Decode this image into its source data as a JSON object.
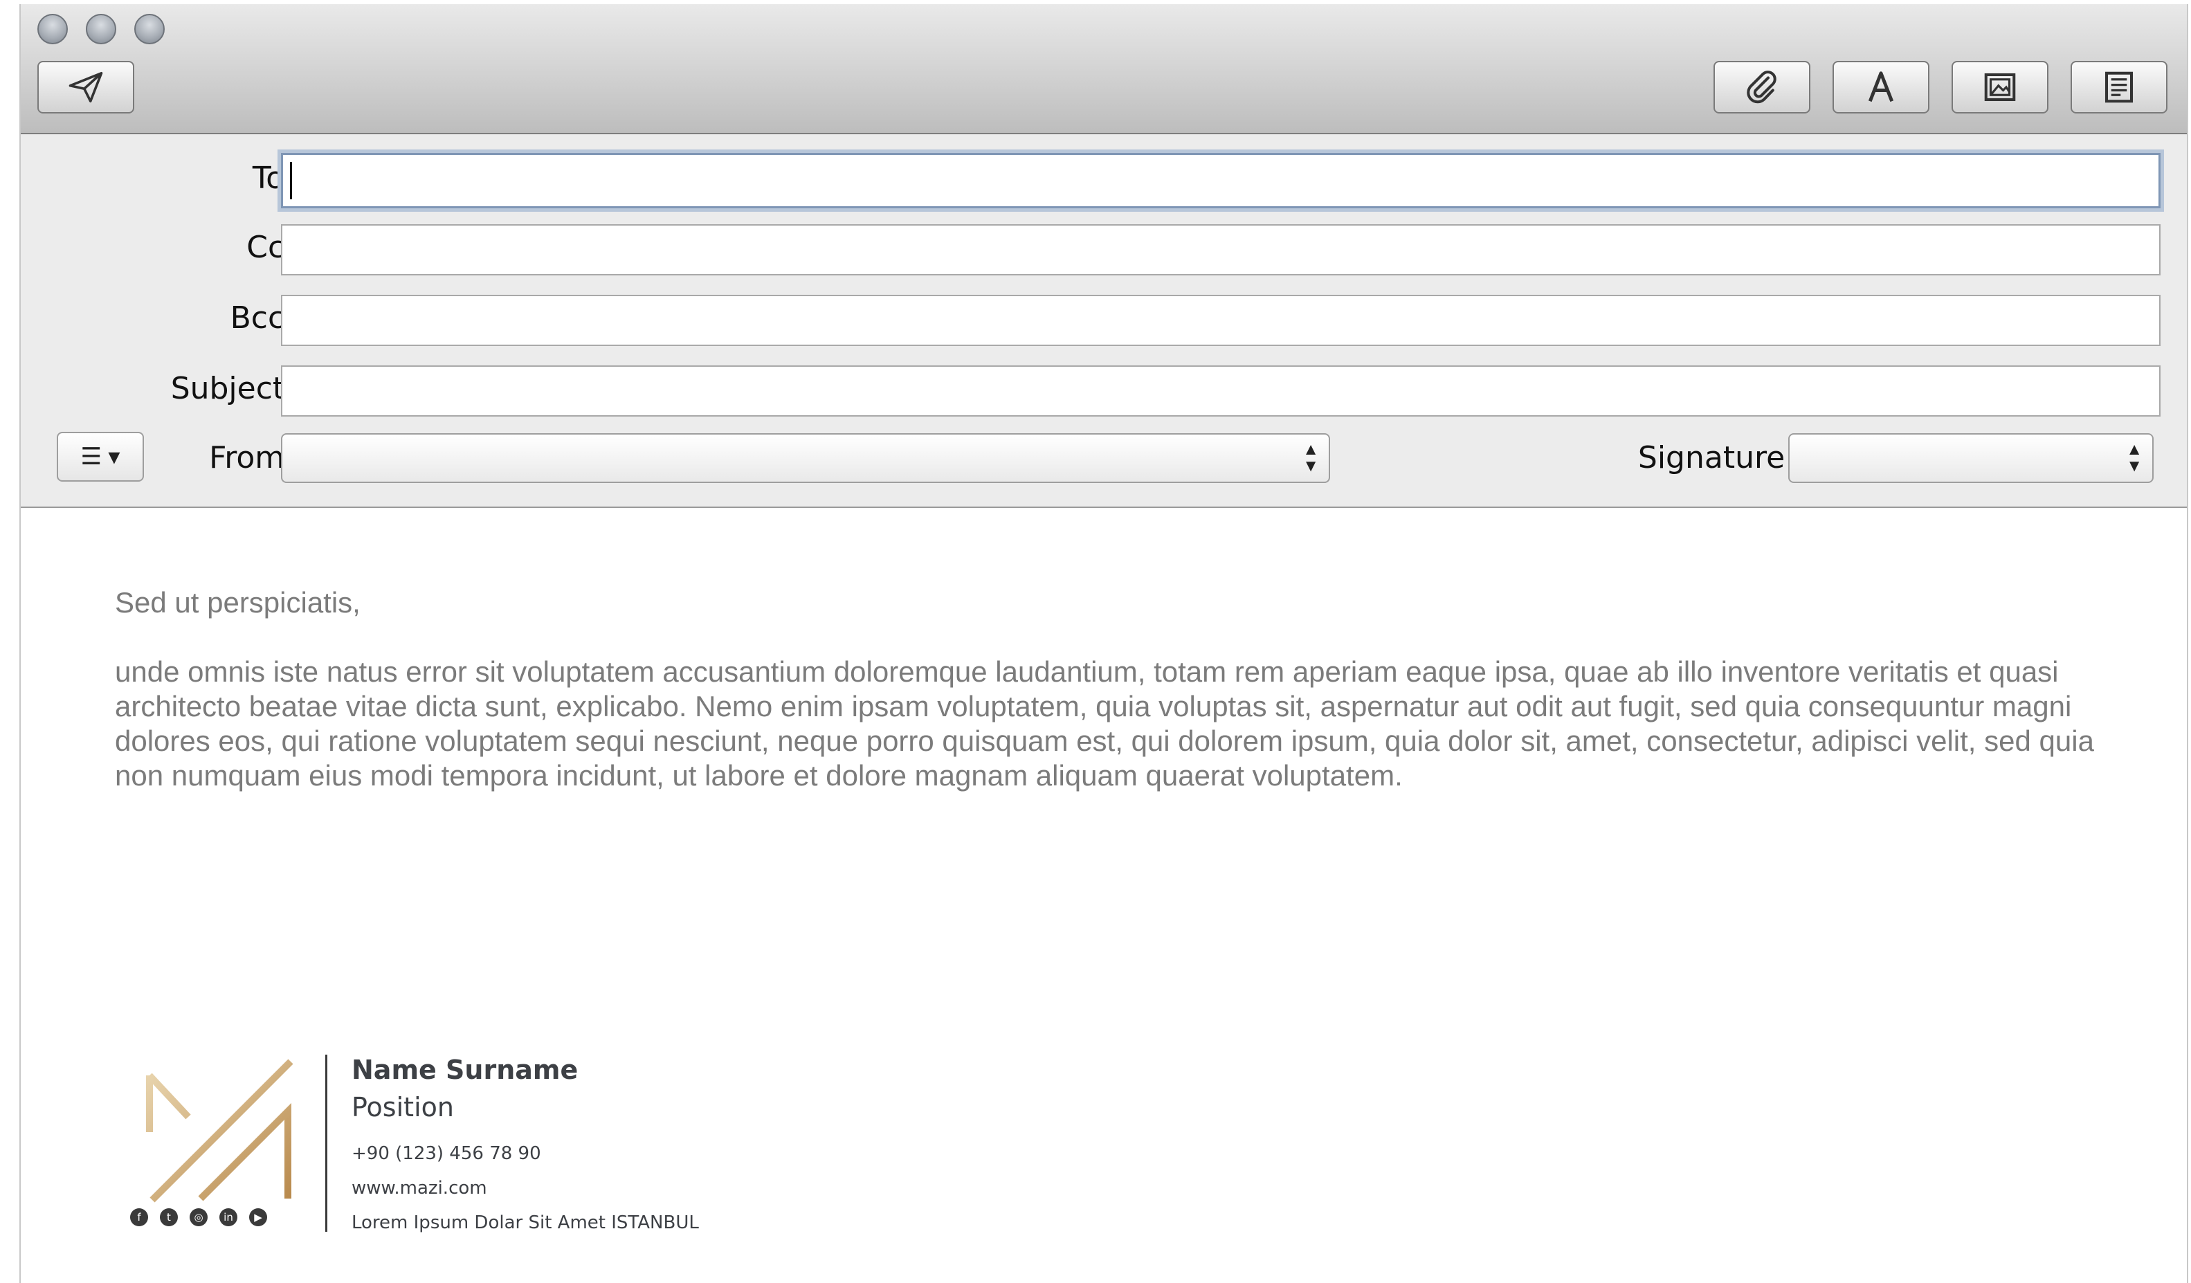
{
  "window": {
    "traffic_lights": [
      "close",
      "minimize",
      "zoom"
    ]
  },
  "toolbar": {
    "send_icon": "paper-plane-icon",
    "buttons": [
      {
        "name": "attach-button",
        "icon": "paperclip-icon"
      },
      {
        "name": "fonts-button",
        "icon": "font-a-icon"
      },
      {
        "name": "photo-browser-button",
        "icon": "photo-icon"
      },
      {
        "name": "stationery-button",
        "icon": "stationery-icon"
      }
    ]
  },
  "headers": {
    "to_label": "To:",
    "cc_label": "Cc:",
    "bcc_label": "Bcc:",
    "subject_label": "Subject:",
    "from_label": "From:",
    "signature_label": "Signature:",
    "to_value": "",
    "cc_value": "",
    "bcc_value": "",
    "subject_value": "",
    "from_value": "",
    "signature_value": "",
    "menu_icon": "list-menu-icon",
    "menu_symbol": "☰ ▾"
  },
  "message": {
    "greeting": "Sed ut perspiciatis,",
    "body": "unde omnis iste natus error sit voluptatem accusantium doloremque laudantium, totam rem aperiam eaque ipsa, quae ab illo inventore veritatis et quasi architecto beatae vitae dicta sunt, explicabo. Nemo enim ipsam voluptatem, quia voluptas sit, aspernatur aut odit aut fugit, sed quia consequuntur magni dolores eos, qui ratione voluptatem sequi nesciunt, neque porro quisquam est, qui dolorem ipsum, quia dolor sit, amet, consectetur, adipisci velit, sed quia non numquam eius modi tempora incidunt, ut labore et dolore magnam aliquam quaerat voluptatem."
  },
  "signature": {
    "name": "Name Surname",
    "position": "Position",
    "phone": "+90 (123) 456 78 90",
    "website": "www.mazi.com",
    "address": "Lorem Ipsum Dolar Sit Amet ISTANBUL",
    "logo_color": "#c9a46a",
    "social_icons": [
      "facebook-icon",
      "twitter-icon",
      "instagram-icon",
      "linkedin-icon",
      "youtube-icon"
    ],
    "social_glyphs": [
      "f",
      "t",
      "◎",
      "in",
      "▶"
    ]
  }
}
